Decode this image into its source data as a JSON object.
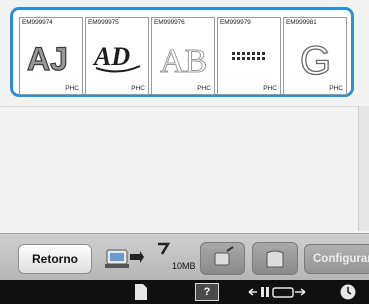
{
  "designs": [
    {
      "code": "EM999974",
      "tag": "PHC",
      "icon": "aj-embroidery-thumbnail"
    },
    {
      "code": "EM999975",
      "tag": "PHC",
      "icon": "ad-script-embroidery-thumbnail"
    },
    {
      "code": "EM999976",
      "tag": "PHC",
      "icon": "ab-sketch-embroidery-thumbnail"
    },
    {
      "code": "EM999979",
      "tag": "PHC",
      "icon": "dotted-pattern-embroidery-thumbnail"
    },
    {
      "code": "EM999981",
      "tag": "PHC",
      "icon": "g-outline-embroidery-thumbnail"
    }
  ],
  "toolbar": {
    "back_label": "Retorno",
    "memory_label": "10MB",
    "settings_label": "Configurar"
  },
  "status": {
    "help_label": "?"
  },
  "colors": {
    "selection": "#2a8fd6",
    "toolbar": "#c3c3c3",
    "statusbar": "#101010"
  }
}
